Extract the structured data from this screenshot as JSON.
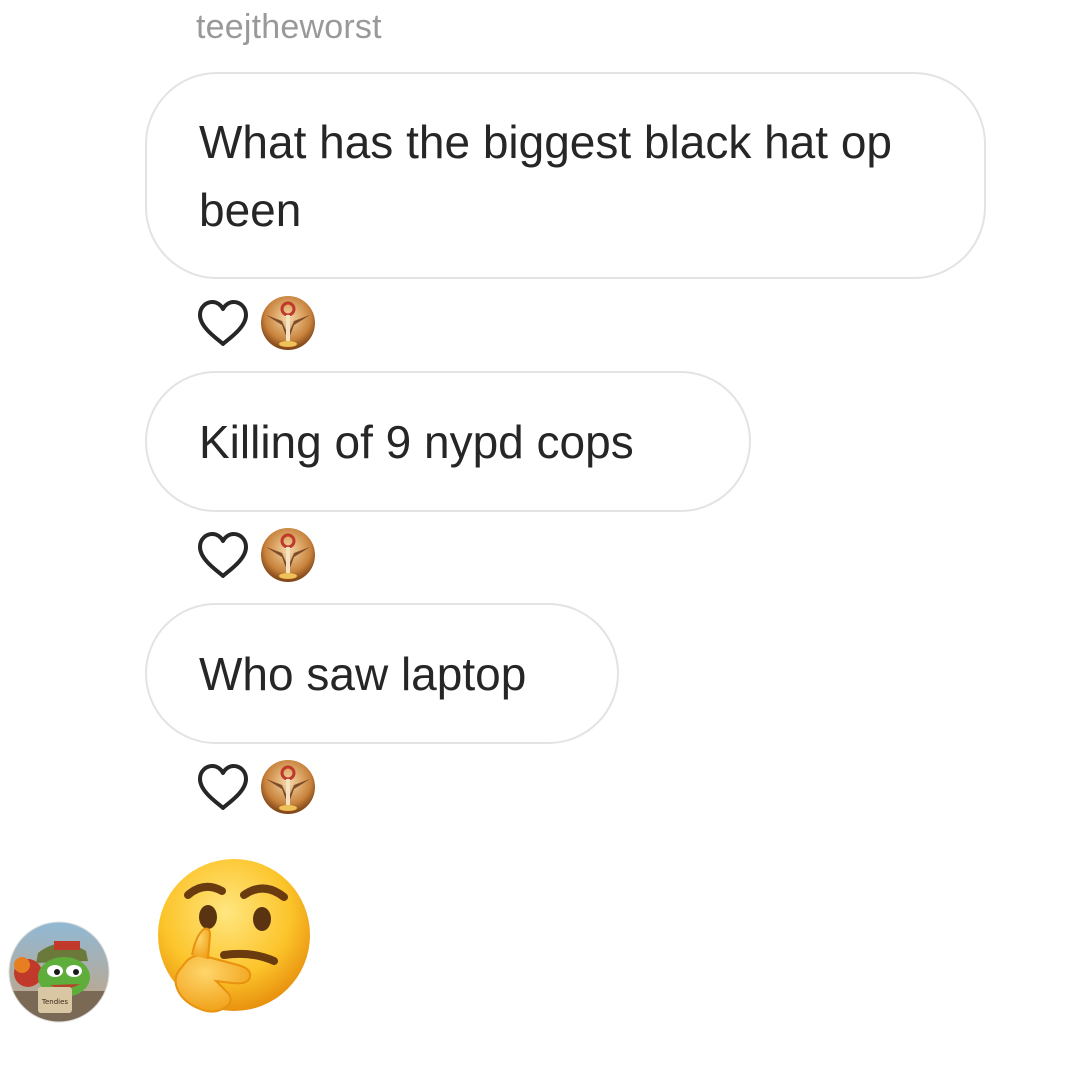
{
  "conversation": {
    "sender_username": "teejtheworst",
    "messages": [
      {
        "text": "What has the biggest black hat op been",
        "liked": false,
        "reactions": 1
      },
      {
        "text": "Killing of 9 nypd cops",
        "liked": false,
        "reactions": 1
      },
      {
        "text": "Who saw laptop",
        "liked": false,
        "reactions": 1
      }
    ],
    "reply": {
      "emoji": "thinking-face"
    },
    "reply_avatar_caption": "Tendies"
  },
  "icons": {
    "like": "heart-outline-icon",
    "reactor": "reactor-avatar",
    "sender": "sender-avatar"
  },
  "colors": {
    "bubble_border": "#e3e3e3",
    "bubble_text": "#262626",
    "username": "#999999",
    "background": "#ffffff"
  }
}
